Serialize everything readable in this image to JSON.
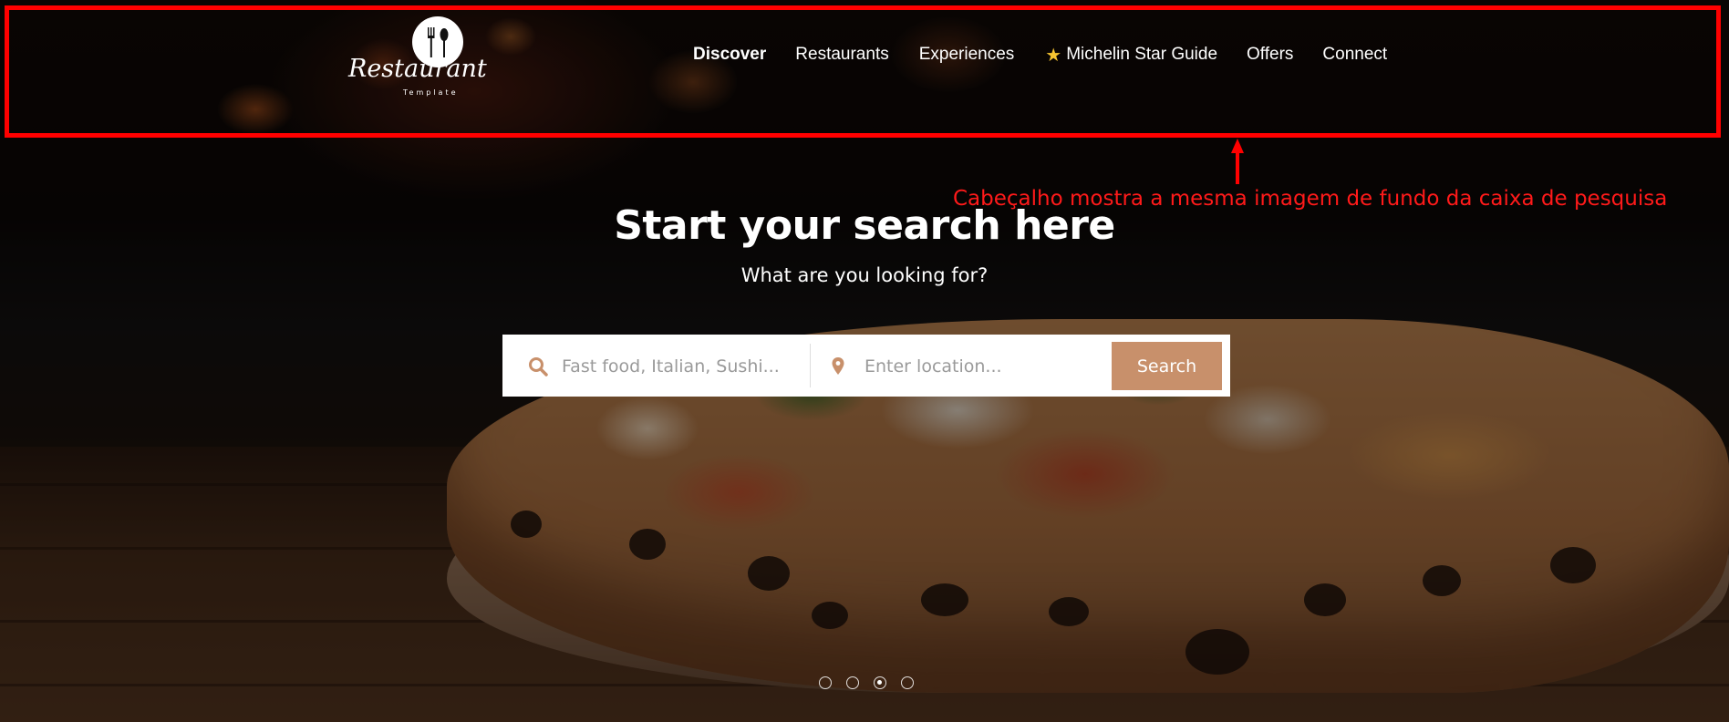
{
  "brand": {
    "script": "Restaurant",
    "sub": "Template"
  },
  "nav": {
    "items": [
      {
        "label": "Discover",
        "active": true
      },
      {
        "label": "Restaurants",
        "active": false
      },
      {
        "label": "Experiences",
        "active": false
      },
      {
        "label": "Michelin Star Guide",
        "active": false,
        "icon": "star-icon"
      },
      {
        "label": "Offers",
        "active": false
      },
      {
        "label": "Connect",
        "active": false
      }
    ]
  },
  "annotation": {
    "text": "Cabeçalho mostra a mesma imagem de fundo da caixa de pesquisa",
    "color": "#ff0000"
  },
  "hero": {
    "title": "Start your search here",
    "subtitle": "What are you looking for?"
  },
  "search": {
    "what_placeholder": "Fast food, Italian, Sushi...",
    "where_placeholder": "Enter location...",
    "button_label": "Search",
    "icons": {
      "what": "search-icon",
      "where": "location-pin-icon"
    },
    "accent_color": "#c8906b"
  },
  "carousel": {
    "count": 4,
    "active_index": 2
  }
}
